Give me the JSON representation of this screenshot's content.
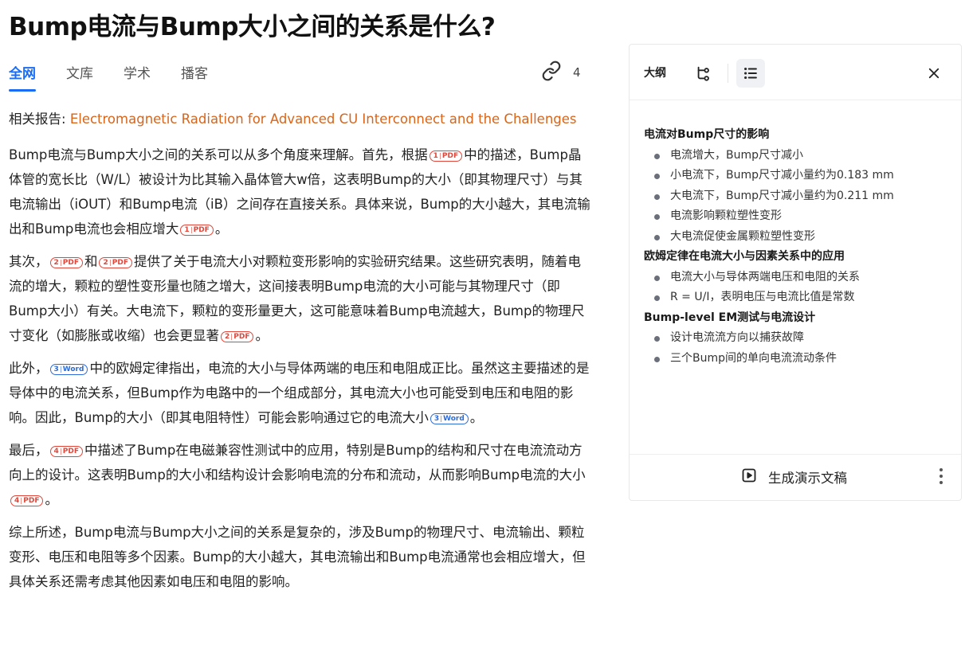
{
  "title": "Bump电流与Bump大小之间的关系是什么?",
  "tabs": [
    {
      "label": "全网",
      "active": true
    },
    {
      "label": "文库",
      "active": false
    },
    {
      "label": "学术",
      "active": false
    },
    {
      "label": "播客",
      "active": false
    }
  ],
  "link_count": "4",
  "related": {
    "label": "相关报告:",
    "link": "Electromagnetic Radiation for Advanced CU Interconnect and the Challenges"
  },
  "citations": {
    "c1": {
      "n": "1",
      "type": "PDF"
    },
    "c2": {
      "n": "2",
      "type": "PDF"
    },
    "c3": {
      "n": "3",
      "type": "Word"
    },
    "c4": {
      "n": "4",
      "type": "PDF"
    }
  },
  "paragraphs": {
    "p1": {
      "s1": "Bump电流与Bump大小之间的关系可以从多个角度来理解。首先，根据",
      "s2": "中的描述，Bump晶体管的宽长比（W/L）被设计为比其输入晶体管大w倍，这表明Bump的大小（即其物理尺寸）与其电流输出（iOUT）和Bump电流（iB）之间存在直接关系。具体来说，Bump的大小越大，其电流输出和Bump电流也会相应增大",
      "s3": "。"
    },
    "p2": {
      "s1": "其次，",
      "s2": "和",
      "s3": "提供了关于电流大小对颗粒变形影响的实验研究结果。这些研究表明，随着电流的增大，颗粒的塑性变形量也随之增大，这间接表明Bump电流的大小可能与其物理尺寸（即Bump大小）有关。大电流下，颗粒的变形量更大，这可能意味着Bump电流越大，Bump的物理尺寸变化（如膨胀或收缩）也会更显著",
      "s4": "。"
    },
    "p3": {
      "s1": "此外，",
      "s2": "中的欧姆定律指出，电流的大小与导体两端的电压和电阻成正比。虽然这主要描述的是导体中的电流关系，但Bump作为电路中的一个组成部分，其电流大小也可能受到电压和电阻的影响。因此，Bump的大小（即其电阻特性）可能会影响通过它的电流大小",
      "s3": "。"
    },
    "p4": {
      "s1": "最后，",
      "s2": "中描述了Bump在电磁兼容性测试中的应用，特别是Bump的结构和尺寸在电流流动方向上的设计。这表明Bump的大小和结构设计会影响电流的分布和流动，从而影响Bump电流的大小",
      "s3": "。"
    },
    "p5": {
      "s1": "综上所述，Bump电流与Bump大小之间的关系是复杂的，涉及Bump的物理尺寸、电流输出、颗粒变形、电压和电阻等多个因素。Bump的大小越大，其电流输出和Bump电流通常也会相应增大，但具体关系还需考虑其他因素如电压和电阻的影响。"
    }
  },
  "panel": {
    "title": "大纲",
    "icons": [
      "mindmap-icon",
      "list-icon",
      "close-icon"
    ],
    "outline": [
      {
        "heading": "电流对Bump尺寸的影响",
        "items": [
          "电流增大，Bump尺寸减小",
          "小电流下，Bump尺寸减小量约为0.183 mm",
          "大电流下，Bump尺寸减小量约为0.211 mm",
          "电流影响颗粒塑性变形",
          "大电流促使金属颗粒塑性变形"
        ]
      },
      {
        "heading": "欧姆定律在电流大小与因素关系中的应用",
        "items": [
          "电流大小与导体两端电压和电阻的关系",
          "R = U/I，表明电压与电流比值是常数"
        ]
      },
      {
        "heading": "Bump-level EM测试与电流设计",
        "items": [
          "设计电流流方向以捕获故障",
          "三个Bump间的单向电流流动条件"
        ]
      }
    ],
    "generate_label": "生成演示文稿"
  },
  "colors": {
    "accent": "#1a6cf5",
    "related_link": "#d7651c",
    "pdf": "#e0473a",
    "word": "#2d6cd8"
  }
}
